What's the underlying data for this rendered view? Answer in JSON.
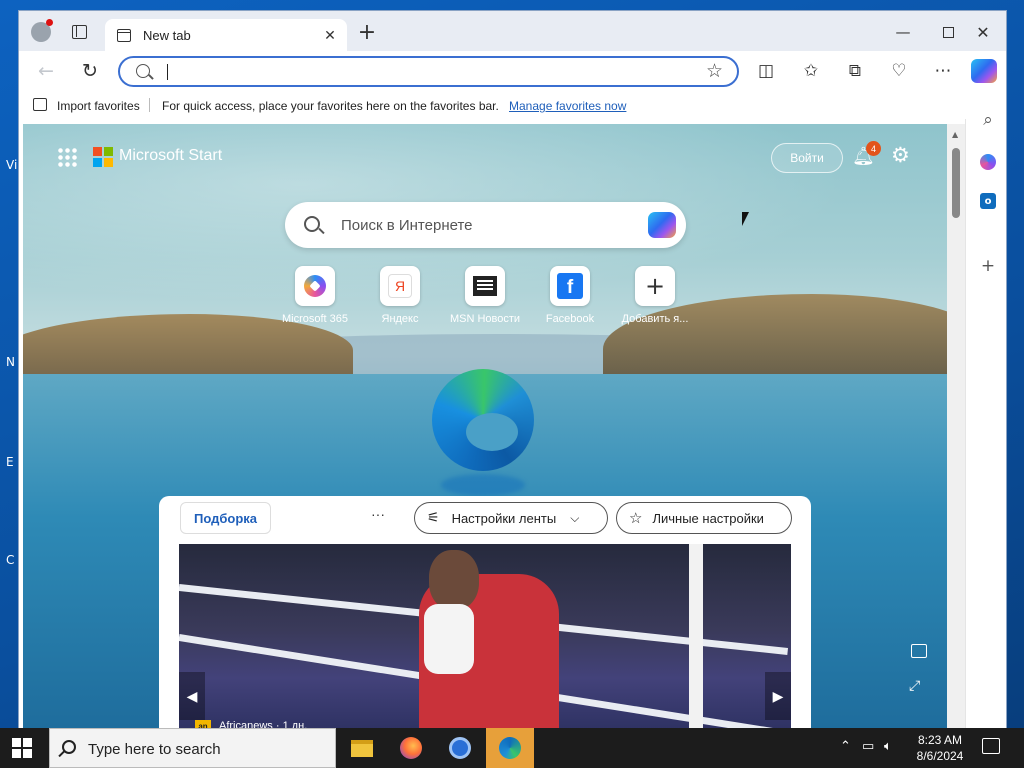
{
  "desktop": {
    "fragments": [
      "Vi",
      "N",
      "E",
      "C"
    ]
  },
  "browser": {
    "tab": {
      "title": "New tab"
    },
    "addressbar": {
      "value": ""
    },
    "favorites_bar": {
      "import_label": "Import favorites",
      "tip": "For quick access, place your favorites here on the favorites bar.",
      "manage_link": "Manage favorites now"
    }
  },
  "start_page": {
    "brand": "Microsoft Start",
    "signin_label": "Войти",
    "notification_count": "4",
    "search": {
      "placeholder": "Поиск в Интернете"
    },
    "quick_links": [
      {
        "label": "Microsoft 365",
        "icon": "microsoft-365-icon"
      },
      {
        "label": "Яндекс",
        "icon": "yandex-icon"
      },
      {
        "label": "MSN Новости",
        "icon": "msn-news-icon"
      },
      {
        "label": "Facebook",
        "icon": "facebook-icon"
      },
      {
        "label": "Добавить я...",
        "icon": "plus-icon"
      }
    ],
    "feed": {
      "tab_label": "Подборка",
      "more_label": "···",
      "feed_settings_label": "Настройки ленты",
      "personal_settings_label": "Личные настройки",
      "hero_source_icon": "an",
      "hero_source": "Africanews · 1 дн."
    }
  },
  "taskbar": {
    "search_placeholder": "Type here to search",
    "time": "8:23 AM",
    "date": "8/6/2024"
  },
  "colors": {
    "accent": "#3b6fd1",
    "link": "#1f5fba",
    "taskbar": "#1c1c1c",
    "badge": "#e2541b"
  }
}
